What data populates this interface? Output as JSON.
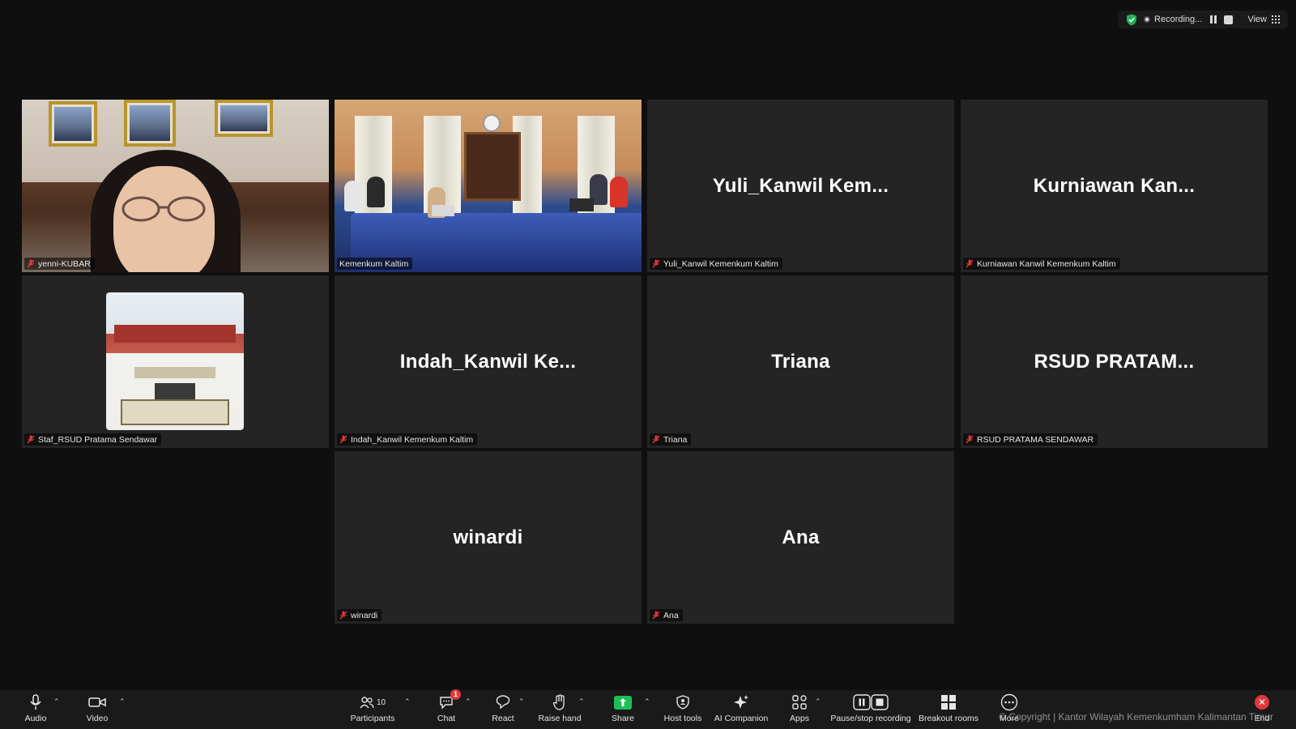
{
  "topbar": {
    "recording_label": "Recording...",
    "view_label": "View"
  },
  "tiles": [
    {
      "name": "yenni-KUBAR",
      "big": ""
    },
    {
      "name": "Kemenkum Kaltim",
      "big": ""
    },
    {
      "name": "Yuli_Kanwil Kemenkum Kaltim",
      "big": "Yuli_Kanwil  Kem..."
    },
    {
      "name": "Kurniawan Kanwil Kemenkum Kaltim",
      "big": "Kurniawan  Kan..."
    },
    {
      "name": "Staf_RSUD Pratama Sendawar",
      "big": ""
    },
    {
      "name": "Indah_Kanwil Kemenkum Kaltim",
      "big": "Indah_Kanwil  Ke..."
    },
    {
      "name": "Triana",
      "big": "Triana"
    },
    {
      "name": "RSUD PRATAMA SENDAWAR",
      "big": "RSUD  PRATAM..."
    },
    {
      "name": "winardi",
      "big": "winardi"
    },
    {
      "name": "Ana",
      "big": "Ana"
    }
  ],
  "toolbar": {
    "audio": "Audio",
    "video": "Video",
    "participants": "Participants",
    "participants_count": "10",
    "chat": "Chat",
    "chat_badge": "1",
    "react": "React",
    "raise_hand": "Raise hand",
    "share": "Share",
    "host_tools": "Host tools",
    "ai_companion": "AI Companion",
    "apps": "Apps",
    "pause_stop_recording": "Pause/stop recording",
    "breakout_rooms": "Breakout rooms",
    "more": "More",
    "end": "End"
  },
  "copyright": "© Copyright | Kantor Wilayah Kemenkumham Kalimantan Timur",
  "colors": {
    "active_speaker": "#27c86a",
    "share": "#1fbf55",
    "end": "#e0393a",
    "tile_bg": "#242424"
  }
}
